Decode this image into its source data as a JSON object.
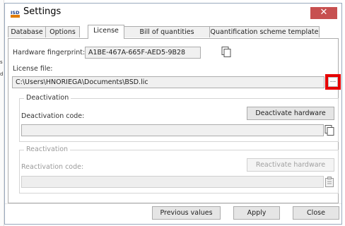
{
  "window": {
    "title": "Settings",
    "close_glyph": "✕",
    "logo_text": "ISD"
  },
  "tabs": [
    {
      "label": "Database",
      "active": false
    },
    {
      "label": "Options",
      "active": false
    },
    {
      "label": "License",
      "active": true
    },
    {
      "label": "Bill of quantities template",
      "active": false
    },
    {
      "label": "Quantification scheme template",
      "active": false
    }
  ],
  "license": {
    "fingerprint_label": "Hardware fingerprint:",
    "fingerprint_value": "A1BE-467A-665F-AED5-9B28",
    "file_label": "License file:",
    "file_value": "C:\\Users\\HNORIEGA\\Documents\\BSD.lic",
    "browse_label": "..."
  },
  "deactivation": {
    "group_title": "Deactivation",
    "code_label": "Deactivation code:",
    "button_label": "Deactivate hardware",
    "code_value": ""
  },
  "reactivation": {
    "group_title": "Reactivation",
    "code_label": "Reactivation code:",
    "button_label": "Reactivate hardware",
    "code_value": "",
    "enabled": false
  },
  "footer": {
    "previous_label": "Previous values",
    "apply_label": "Apply",
    "close_label": "Close"
  },
  "left_strip_marks": [
    "s",
    "d"
  ],
  "colors": {
    "close_button": "#c75050",
    "highlight": "#e60000",
    "border": "#acacac"
  },
  "icons": {
    "copy": "copy-icon",
    "paste": "paste-icon",
    "close": "close-icon",
    "logo": "app-logo-icon"
  }
}
